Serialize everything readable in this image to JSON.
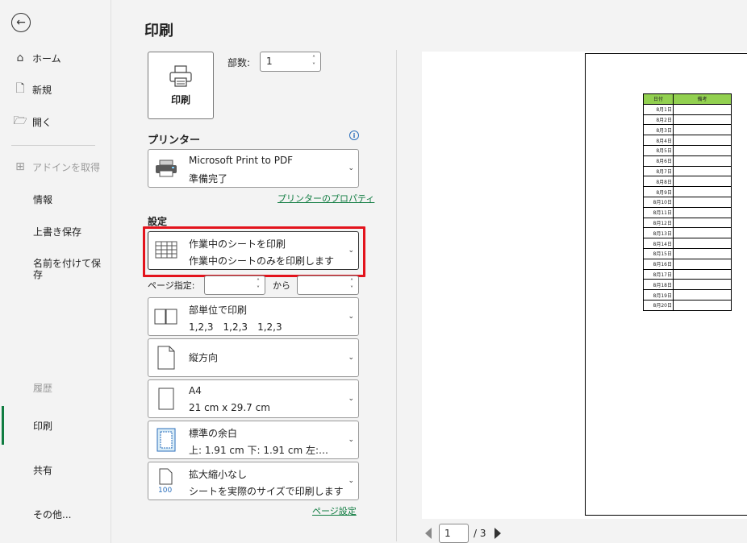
{
  "sidebar": {
    "back_icon": "back-arrow-icon",
    "items": [
      {
        "label": "ホーム",
        "icon": "home-icon"
      },
      {
        "label": "新規",
        "icon": "new-document-icon"
      },
      {
        "label": "開く",
        "icon": "folder-open-icon"
      },
      {
        "label": "アドインを取得",
        "icon": "grid-icon"
      },
      {
        "label": "情報"
      },
      {
        "label": "上書き保存"
      },
      {
        "label": "名前を付けて保存"
      },
      {
        "label": "履歴"
      },
      {
        "label": "印刷"
      },
      {
        "label": "共有"
      },
      {
        "label": "その他..."
      }
    ]
  },
  "panel": {
    "title": "印刷",
    "print_button_label": "印刷",
    "copies_label": "部数:",
    "copies_value": "1"
  },
  "printer": {
    "heading": "プリンター",
    "name": "Microsoft Print to PDF",
    "status": "準備完了",
    "properties_link": "プリンターのプロパティ"
  },
  "settings": {
    "heading": "設定",
    "scope_title": "作業中のシートを印刷",
    "scope_sub": "作業中のシートのみを印刷します",
    "pages_label": "ページ指定:",
    "from_label": "から",
    "collate_title": "部単位で印刷",
    "collate_sub": "1,2,3　1,2,3　1,2,3",
    "orientation": "縦方向",
    "paper_title": "A4",
    "paper_sub": "21 cm x 29.7 cm",
    "margins_title": "標準の余白",
    "margins_sub": "上: 1.91 cm 下: 1.91 cm 左:…",
    "scaling_title": "拡大縮小なし",
    "scaling_sub": "シートを実際のサイズで印刷します",
    "page_setup_link": "ページ設定"
  },
  "preview": {
    "table_headers": [
      "日付",
      "備考"
    ],
    "dates": [
      "8月1日",
      "8月2日",
      "8月3日",
      "8月4日",
      "8月5日",
      "8月6日",
      "8月7日",
      "8月8日",
      "8月9日",
      "8月10日",
      "8月11日",
      "8月12日",
      "8月13日",
      "8月14日",
      "8月15日",
      "8月16日",
      "8月17日",
      "8月18日",
      "8月19日",
      "8月20日"
    ],
    "header_color": "#92d050"
  },
  "pager": {
    "current": "1",
    "total": "/ 3"
  },
  "colors": {
    "accent": "#107c41",
    "highlight": "#e3131c"
  }
}
